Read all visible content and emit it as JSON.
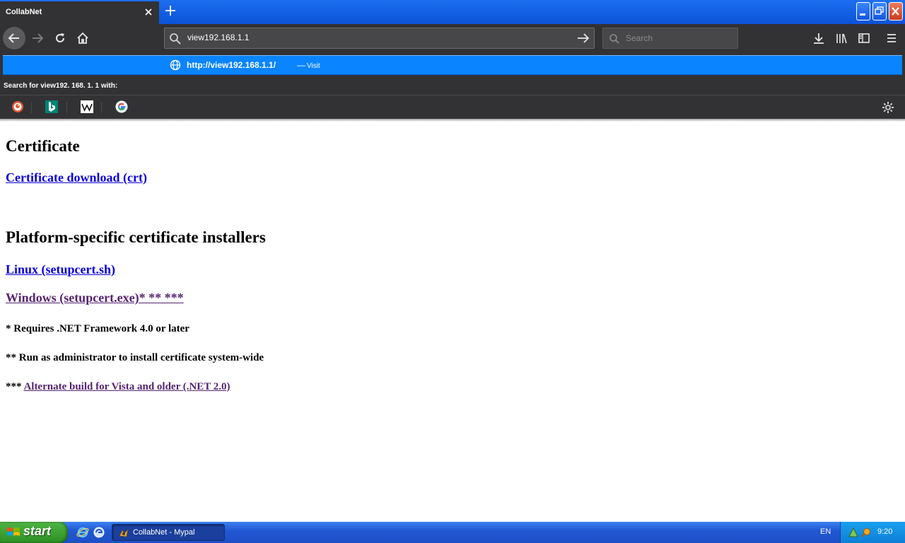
{
  "browser": {
    "tab_title": "CollabNet",
    "url_input_value": "view192.168.1.1",
    "search_placeholder": "Search",
    "autocomplete": {
      "url": "http://view192.168.1.1/",
      "separator": "—",
      "action": "Visit",
      "search_with_label": "Search for view192. 168. 1. 1 with:",
      "engines": [
        "duckduckgo-icon",
        "bing-icon",
        "wikipedia-icon",
        "google-icon"
      ]
    },
    "accent_color": "#0a84ff",
    "toolbar_color": "#323234"
  },
  "page": {
    "heading_certificate": "Certificate",
    "link_crt": "Certificate download (crt)",
    "heading_platform": "Platform-specific certificate installers",
    "link_linux": "Linux (setupcert.sh)",
    "link_windows": "Windows (setupcert.exe)* ** ***",
    "note_1": "* Requires .NET Framework 4.0 or later",
    "note_2": "** Run as administrator to install certificate system-wide",
    "note_3_prefix": "***",
    "note_3_link": "Alternate build for Vista and older (.NET 2.0)",
    "link_color": "#0b00d9",
    "visited_color": "#55246f"
  },
  "taskbar": {
    "start_label": "start",
    "task_label": "CollabNet - Mypal",
    "language": "EN",
    "clock": "9:20"
  }
}
